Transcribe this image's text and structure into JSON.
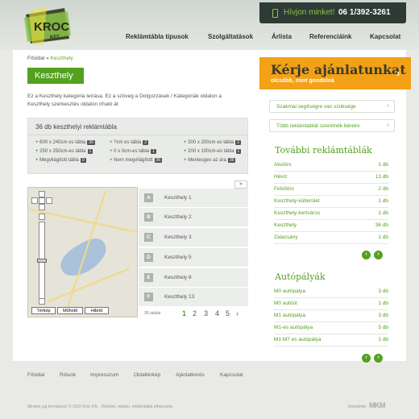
{
  "header": {
    "logo_text": "KROC",
    "logo_subtext": "KFT",
    "phone_label": "Hívjon minket!",
    "phone_number": "06 1/392-3261",
    "nav": [
      "Reklámtábla típusok",
      "Szolgáltatások",
      "Árlista",
      "Referenciáink",
      "Kapcsolat"
    ]
  },
  "breadcrumb": {
    "home": "Főoldal",
    "sep": "»",
    "current": "Keszthely"
  },
  "page_title": "Keszthely",
  "intro": "Ez a Keszthely kategória leírása. Ez a szöveg a Dolgozzásek / Kategóriák oldalon a Keszthely szerkesztés oldalon írható át",
  "counts": {
    "title": "36 db keszthelyi reklámtábla",
    "columns": [
      [
        {
          "text": "600 x 240cm es tábla",
          "badge": "30"
        },
        {
          "text": "250 x 250cm-es tábla",
          "badge": "1"
        },
        {
          "text": "Megvilágított tábla",
          "badge": "0"
        }
      ],
      [
        {
          "text": "?cm es tábla",
          "badge": "2"
        },
        {
          "text": "0 x 0cm-es tábla",
          "badge": "1"
        },
        {
          "text": "Nem megvilágított",
          "badge": "36"
        }
      ],
      [
        {
          "text": "300 x 200cm es tábla",
          "badge": "2"
        },
        {
          "text": "200 x 100cm-es tábla",
          "badge": "1"
        },
        {
          "text": "Mentesges az ára",
          "badge": "36"
        }
      ]
    ]
  },
  "map": {
    "buttons": [
      "Térkép",
      "Műhold",
      "Hibrid"
    ]
  },
  "list": {
    "expand": "»",
    "items": [
      {
        "letter": "A",
        "name": "Keszthely 1"
      },
      {
        "letter": "B",
        "name": "Keszthely 2"
      },
      {
        "letter": "C",
        "name": "Keszthely 3"
      },
      {
        "letter": "D",
        "name": "Keszthely 5"
      },
      {
        "letter": "E",
        "name": "Keszthely 8"
      },
      {
        "letter": "F",
        "name": "Keszthely 13"
      }
    ],
    "pager_label": "36 találat",
    "pages": [
      "1",
      "2",
      "3",
      "4",
      "5"
    ],
    "next": "›"
  },
  "cta": {
    "title": "Kérje ajánlatunkat",
    "subtitle": "olcsóbb, mint gondolná",
    "arrow": "›"
  },
  "side_buttons": [
    {
      "label": "Szakmai segítségre van szüksége",
      "arrow": "›"
    },
    {
      "label": "Több reklámtáblát szeretnék bérelni",
      "arrow": "›"
    }
  ],
  "more_boards": {
    "title": "További reklámtáblák",
    "items": [
      {
        "name": "Alsóörs",
        "count": "1 db"
      },
      {
        "name": "Hévíz",
        "count": "13 db"
      },
      {
        "name": "Felsőörs",
        "count": "2 db"
      },
      {
        "name": "Keszthely-külterület",
        "count": "1 db"
      },
      {
        "name": "Keszthely-kertváros",
        "count": "1 db"
      },
      {
        "name": "Keszthely",
        "count": "36 db"
      },
      {
        "name": "Zalacsány",
        "count": "1 db"
      }
    ]
  },
  "highways": {
    "title": "Autópályák",
    "items": [
      {
        "name": "M0 autópálya",
        "count": "3 db"
      },
      {
        "name": "M0 autóút",
        "count": "1 db"
      },
      {
        "name": "M1 autópálya",
        "count": "3 db"
      },
      {
        "name": "M1-es autópálya",
        "count": "5 db"
      },
      {
        "name": "M1 M7 es autópálya",
        "count": "1 db"
      }
    ]
  },
  "pager_arrows": {
    "prev": "‹",
    "next": "›"
  },
  "footer": {
    "links": [
      "Főoldal",
      "Rólunk",
      "Impresszum",
      "Oldaltérkép",
      "Ajánlatkérés",
      "Kapcsolat"
    ],
    "copyright": "Minden jog fenntartva! © 2010 Kroc Kft. - Reklám, reklám, reklámtábla elhelyezés",
    "made_by_label": "Készítette:",
    "made_by": "MKM"
  },
  "colors": {
    "green": "#54a11f",
    "orange": "#f3a116",
    "dark": "#2e3a36"
  }
}
